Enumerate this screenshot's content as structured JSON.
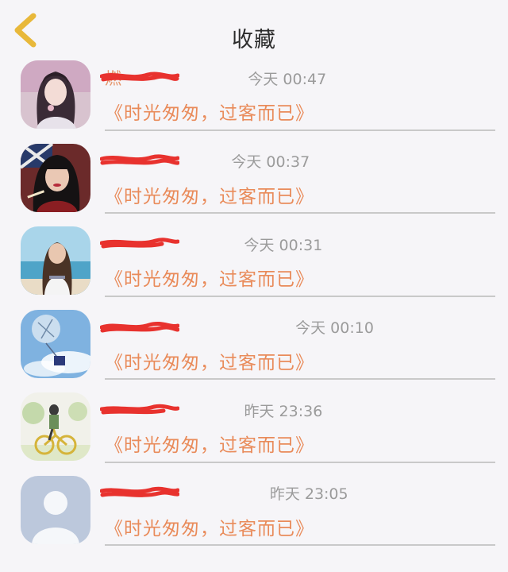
{
  "header": {
    "title": "收藏",
    "back_icon": "chevron-left-icon",
    "accent_color": "#e8b83a"
  },
  "favorites": [
    {
      "username": "燃",
      "time": "今天 00:47",
      "quote": "《时光匆匆，过客而已》",
      "avatar": "girl-pink-portrait"
    },
    {
      "username": "",
      "time": "今天 00:37",
      "quote": "《时光匆匆，过客而已》",
      "avatar": "woman-dark-hair-portrait"
    },
    {
      "username": "",
      "time": "今天 00:31",
      "quote": "《时光匆匆，过客而已》",
      "avatar": "woman-beach-portrait"
    },
    {
      "username": "",
      "time": "今天 00:10",
      "quote": "《时光匆匆，过客而已》",
      "avatar": "balloon-sky-illustration"
    },
    {
      "username": "",
      "time": "昨天 23:36",
      "quote": "《时光匆匆，过客而已》",
      "avatar": "cyclist-illustration"
    },
    {
      "username": "",
      "time": "昨天 23:05",
      "quote": "《时光匆匆，过客而已》",
      "avatar": "default-user-silhouette"
    }
  ],
  "colors": {
    "username": "#e5956b",
    "quote": "#e98b5a",
    "time": "#9b9b9b",
    "redaction": "#e8322e"
  }
}
